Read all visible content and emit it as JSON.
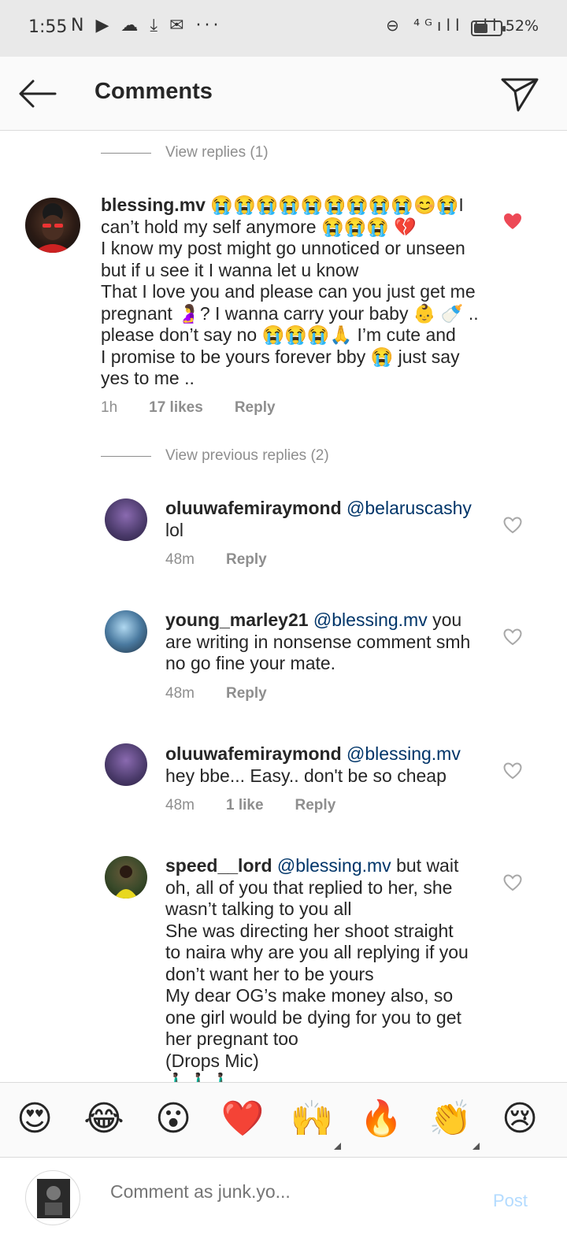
{
  "status_bar": {
    "time": "1:55",
    "left_icons": "N ▶ ☁ ⤓ ✉ ···",
    "right_icons": "⊖ ⁴ᴳıll ıll",
    "battery": "52%",
    "battery_level": 0.52
  },
  "header": {
    "title": "Comments"
  },
  "thread": {
    "view_replies_top": "View replies (1)",
    "main_comment": {
      "username": "blessing.mv",
      "lines": [
        "😭😭😭😭😭😭😭😭😭😊😭I",
        "can’t hold my self anymore 😭😭😭 💔",
        "I know my post might go unnoticed or unseen",
        "but if u see it I wanna let u know",
        "That I love you and please can you just get me",
        "pregnant 🤰? I wanna carry your baby 👶 🍼 ..",
        "please don’t say no 😭😭😭🙏 I’m cute  and",
        "I promise to be yours forever bby 😭 just say",
        "yes to me .."
      ],
      "time": "1h",
      "likes": "17 likes",
      "reply": "Reply",
      "liked": true
    },
    "view_previous": "View previous replies (2)",
    "replies": [
      {
        "username": "oluuwafemiraymond",
        "mention": "@belaruscashy",
        "rest_first": "",
        "lines": [
          "lol"
        ],
        "time": "48m",
        "likes": "",
        "reply": "Reply"
      },
      {
        "username": "young_marley21",
        "mention": "@blessing.mv",
        "rest_first": " you",
        "lines": [
          "are writing in nonsense comment smh",
          "no go fine your mate."
        ],
        "time": "48m",
        "likes": "",
        "reply": "Reply"
      },
      {
        "username": "oluuwafemiraymond",
        "mention": "@blessing.mv",
        "rest_first": "",
        "lines": [
          "hey bbe... Easy.. don't be so cheap"
        ],
        "time": "48m",
        "likes": "1 like",
        "reply": "Reply"
      },
      {
        "username": "speed__lord",
        "mention": "@blessing.mv",
        "rest_first": " but wait",
        "lines": [
          "oh, all of you that replied to her, she",
          "wasn’t talking to you all",
          "She was directing her shoot straight",
          "to naira why are you all replying if you",
          "don’t want her to be yours",
          "My dear OG’s make money also, so",
          "one girl would be dying for you to get",
          "her pregnant too",
          "(Drops Mic)",
          "🚶🏿‍♂️🚶🏿‍♂️🚶🏿‍♂️"
        ],
        "time": "",
        "likes": "",
        "reply": ""
      }
    ]
  },
  "emoji_bar": [
    "😍",
    "😂",
    "😮",
    "❤️",
    "🙌",
    "🔥",
    "👏",
    "😢"
  ],
  "input": {
    "placeholder": "Comment as junk.yo...",
    "post_label": "Post"
  },
  "colors": {
    "like_red": "#ed4956",
    "mention_blue": "#003569",
    "post_disabled": "#b3dbff"
  }
}
